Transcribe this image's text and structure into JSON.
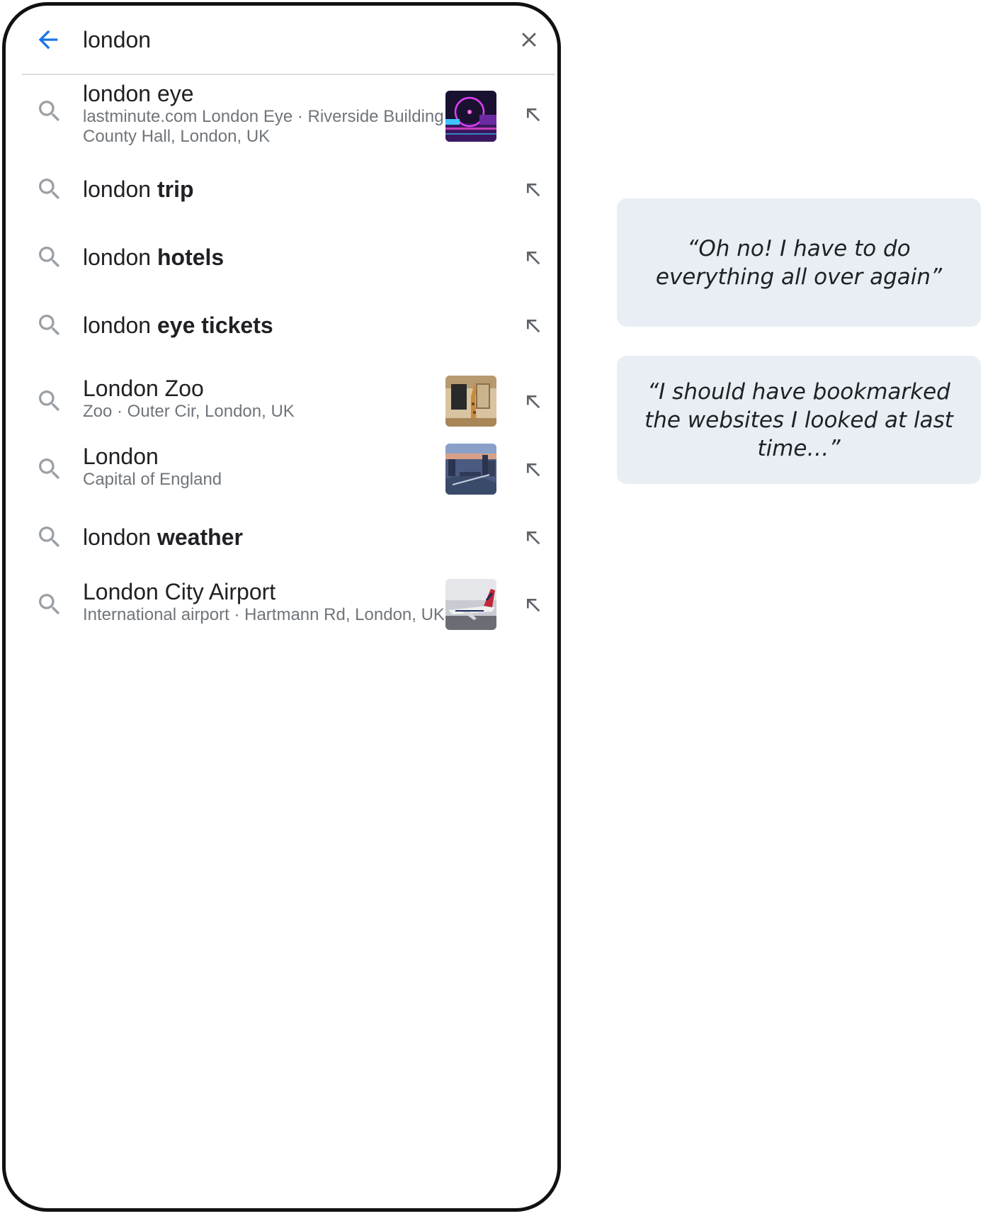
{
  "search": {
    "query": "london",
    "back_icon": "arrow-left-icon",
    "clear_icon": "close-icon"
  },
  "suggestions": [
    {
      "prefix": "london eye",
      "bold": "",
      "subtitle_line1": "lastminute.com London Eye · Riverside Building,",
      "subtitle_line2": "County Hall, London, UK",
      "thumbnail": "london-eye-night"
    },
    {
      "prefix": "london ",
      "bold": "trip"
    },
    {
      "prefix": "london ",
      "bold": "hotels"
    },
    {
      "prefix": "london ",
      "bold": "eye tickets"
    },
    {
      "prefix": "London Zoo",
      "bold": "",
      "subtitle_line1": "Zoo · Outer Cir, London, UK",
      "thumbnail": "zoo-giraffe"
    },
    {
      "prefix": "London",
      "bold": "",
      "subtitle_line1": "Capital of England",
      "thumbnail": "london-skyline-dusk"
    },
    {
      "prefix": "london ",
      "bold": "weather"
    },
    {
      "prefix": "London City Airport",
      "bold": "",
      "subtitle_line1": "International airport · Hartmann Rd, London, UK",
      "thumbnail": "airplane-tarmac"
    }
  ],
  "quotes": [
    {
      "text_line1": "“Oh no! I have to do",
      "text_line2": "everything all over again”"
    },
    {
      "text_line1": "“I should have bookmarked",
      "text_line2": "the websites I looked at last",
      "text_line3": "time…”"
    }
  ],
  "colors": {
    "accent": "#1a73e8",
    "bubble": "#e8eef4",
    "frame": "#111111",
    "subtext": "#70757a"
  }
}
